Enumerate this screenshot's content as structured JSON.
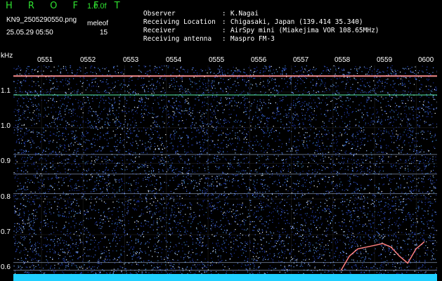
{
  "app": {
    "title": "H R O F F T",
    "version": "1.0.0f"
  },
  "file": {
    "name": "KN9_2505290550.png",
    "datetime": "25.05.29 05:50"
  },
  "unit": {
    "label": "meleof",
    "value": "15"
  },
  "metadata": [
    {
      "label": "Observer",
      "value": "K.Nagai"
    },
    {
      "label": "Receiving Location",
      "value": "Chigasaki, Japan (139.414 35.340)"
    },
    {
      "label": "Receiver",
      "value": "AirSpy mini (Miakejima VOR 108.65MHz)"
    },
    {
      "label": "Receiving antenna",
      "value": "Maspro FM-3"
    }
  ],
  "colors": {
    "title": "#2fe030",
    "background": "#000000",
    "noise_dark": "#0a1a66",
    "baseline": "#20d0ff"
  },
  "chart_data": {
    "type": "heatmap",
    "title": "",
    "xlabel": "",
    "ylabel": "kHz",
    "x_ticks": [
      "0551",
      "0552",
      "0553",
      "0554",
      "0555",
      "0556",
      "0557",
      "0558",
      "0559",
      "0600"
    ],
    "y_ticks": [
      "1.1",
      "1.0",
      "0.9",
      "0.8",
      "0.7",
      "0.6"
    ],
    "ylim": [
      0.57,
      1.175
    ],
    "horizontal_lines_khz": [
      1.145,
      1.092,
      0.925,
      0.87,
      0.815,
      0.622,
      0.6
    ],
    "grid": true,
    "trace": {
      "x_minutes": [
        58.2,
        58.4,
        58.6,
        58.8,
        59.0,
        59.2,
        59.4,
        59.6,
        59.8,
        60.0,
        60.2
      ],
      "y_khz": [
        0.6,
        0.64,
        0.66,
        0.665,
        0.67,
        0.675,
        0.665,
        0.64,
        0.62,
        0.66,
        0.68
      ]
    }
  }
}
